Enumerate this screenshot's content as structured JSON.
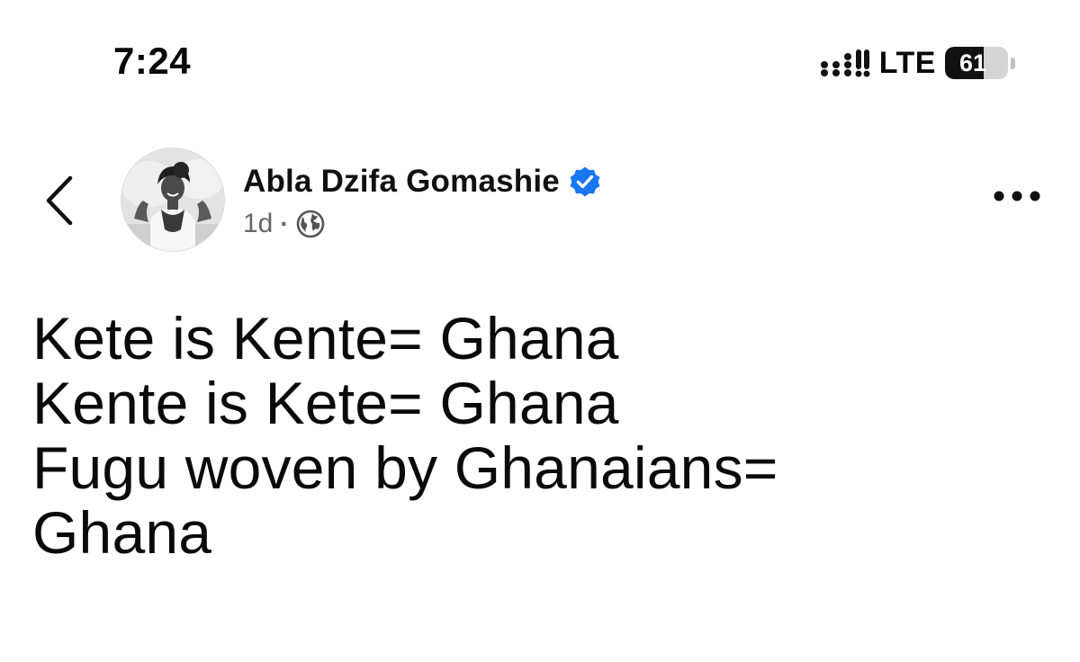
{
  "status_bar": {
    "time": "7:24",
    "network": "LTE",
    "battery_level": "61",
    "battery_fraction": 0.61,
    "icons": [
      "signal-icon",
      "battery-icon"
    ]
  },
  "post": {
    "author": {
      "name": "Abla Dzifa Gomashie",
      "verified": true
    },
    "time": "1d",
    "meta_separator": "·",
    "icons": [
      "back-chevron-icon",
      "verified-badge-icon",
      "globe-icon",
      "more-dots-icon"
    ],
    "lines": [
      "Kete is Kente= Ghana",
      "Kente is Kete= Ghana",
      "Fugu woven by Ghanaians=",
      "Ghana"
    ]
  },
  "colors": {
    "verified_blue": "#1877f2",
    "text_primary": "#0a0a0a",
    "text_secondary": "#666666"
  }
}
